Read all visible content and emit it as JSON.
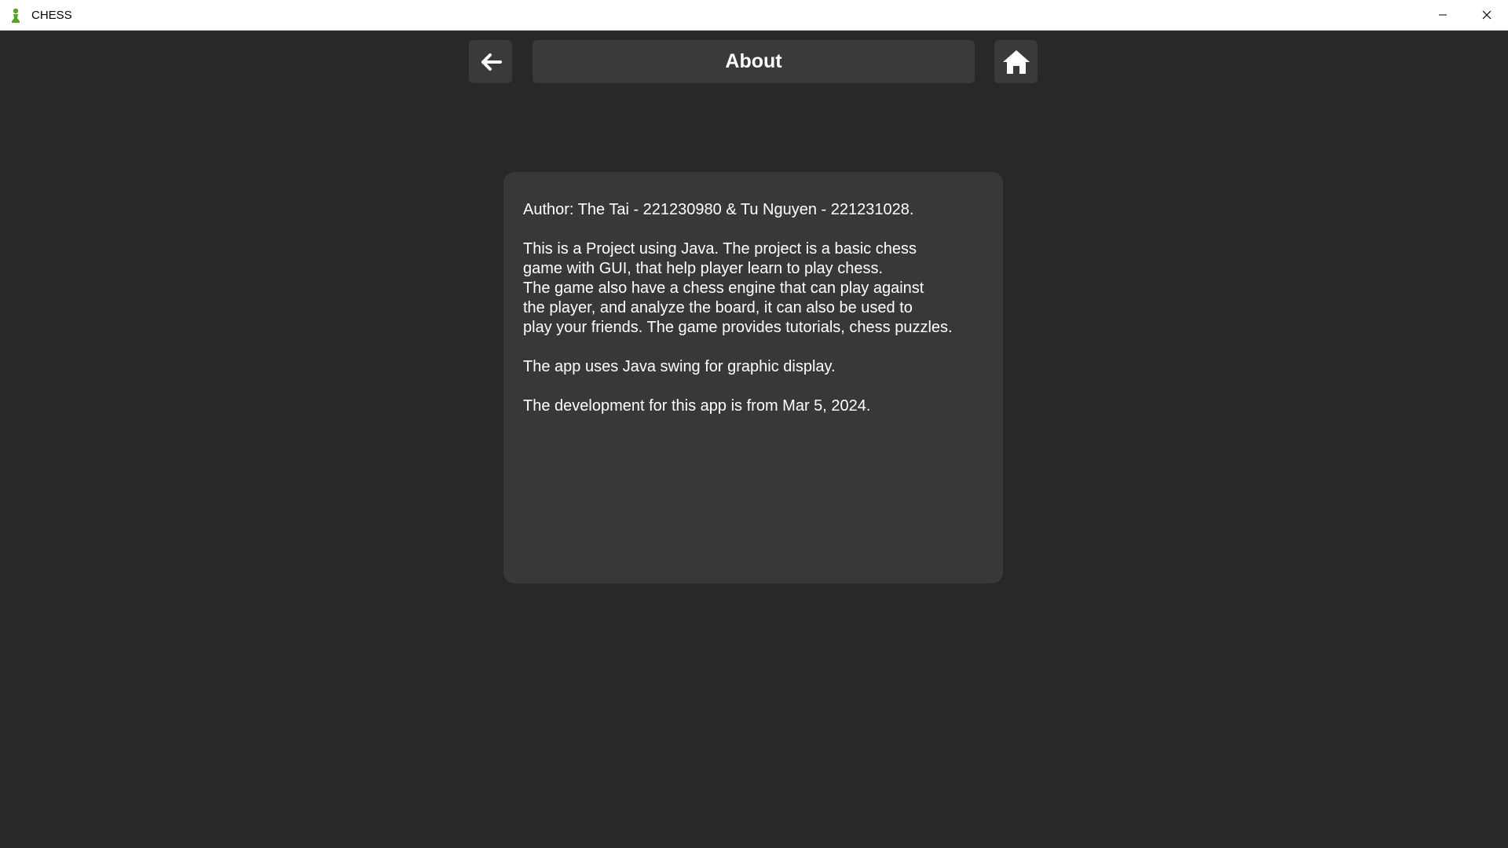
{
  "window": {
    "title": "CHESS",
    "app_icon": "chess-pawn-icon",
    "controls": {
      "minimize_icon": "minimize-icon",
      "close_icon": "close-icon"
    }
  },
  "header": {
    "title": "About",
    "back_icon": "arrow-left-icon",
    "home_icon": "home-icon"
  },
  "about": {
    "author": "Author: The Tai - 221230980 & Tu Nguyen - 221231028.",
    "description": "This is a Project using Java. The project is a basic chess\ngame with GUI, that help player learn to play chess.\nThe game also have a chess engine that can play against\nthe player, and analyze the board, it can also be used to\nplay your friends. The game provides tutorials, chess puzzles.",
    "tech": "The app uses Java swing for graphic display.",
    "development": "The development for this app is from Mar 5, 2024."
  },
  "colors": {
    "background": "#282828",
    "panel": "#3a3a3a",
    "card": "#383838",
    "text": "#ffffff",
    "app_icon": "#5aa02c"
  }
}
